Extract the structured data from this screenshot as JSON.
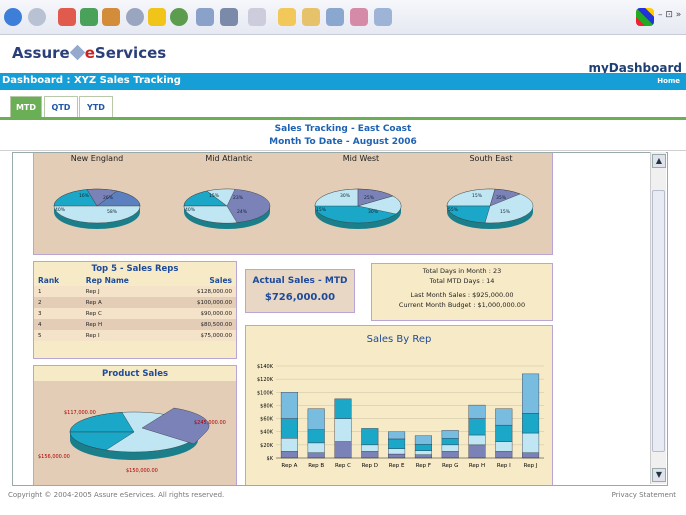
{
  "header": {
    "logo_part1": "Assure",
    "logo_part2": "e",
    "logo_part3": "Services",
    "mydashboard": "myDashboard",
    "home_link": "Home",
    "dashboard_title": "Dashboard : XYZ Sales Tracking"
  },
  "tabs": [
    {
      "label": "MTD",
      "active": true
    },
    {
      "label": "QTD",
      "active": false
    },
    {
      "label": "YTD",
      "active": false
    }
  ],
  "section": {
    "title": "Sales Tracking - East Coast",
    "subtitle": "Month To Date - August 2006"
  },
  "regions": [
    "New England",
    "Mid Atlantic",
    "Mid West",
    "South East"
  ],
  "region_pies": [
    [
      "16%",
      "26%",
      "58%",
      "40%"
    ],
    [
      "15%",
      "23%",
      "24%",
      "40%"
    ],
    [
      "30%",
      "25%",
      "30%",
      "15%"
    ],
    [
      "15%",
      "35%",
      "15%",
      "55%"
    ]
  ],
  "top5": {
    "title": "Top 5 - Sales Reps",
    "headers": [
      "Rank",
      "Rep Name",
      "Sales"
    ],
    "rows": [
      [
        "1",
        "Rep J",
        "$128,000.00"
      ],
      [
        "2",
        "Rep A",
        "$100,000.00"
      ],
      [
        "3",
        "Rep C",
        "$90,000.00"
      ],
      [
        "4",
        "Rep H",
        "$80,500.00"
      ],
      [
        "5",
        "Rep I",
        "$75,000.00"
      ]
    ]
  },
  "actual_sales": {
    "title": "Actual Sales - MTD",
    "value": "$726,000.00"
  },
  "stats": {
    "days_in_month": "Total Days in Month : 23",
    "mtd_days": "Total MTD Days : 14",
    "last_month": "Last Month Sales : $925,000.00",
    "budget": "Current Month Budget : $1,000,000.00"
  },
  "product_sales": {
    "title": "Product Sales",
    "labels": [
      "$117,000.00",
      "$245,000.00",
      "$156,000.00",
      "$150,000.00"
    ]
  },
  "footer": {
    "copyright": "Copyright © 2004-2005 Assure eServices. All rights reserved.",
    "privacy": "Privacy Statement"
  },
  "colors": {
    "blue_bar": "#169fd7",
    "tab_green": "#6aae55",
    "panel_tan": "#e3cdb6",
    "panel_cream": "#f7ebc7",
    "bar_purple": "#7b82b8",
    "bar_teal": "#1aa7c8",
    "bar_light": "#bfe6f2",
    "bar_sky": "#78bde0"
  },
  "chart_data": {
    "type": "bar",
    "title": "Sales By Rep",
    "categories": [
      "Rep A",
      "Rep B",
      "Rep C",
      "Rep D",
      "Rep E",
      "Rep F",
      "Rep G",
      "Rep H",
      "Rep I",
      "Rep J"
    ],
    "y_ticks": [
      "$140K",
      "$120K",
      "$100K",
      "$80K",
      "$60K",
      "$40K",
      "$20K",
      "$K"
    ],
    "ylim": [
      0,
      140000
    ],
    "stacked": true,
    "series": [
      {
        "color": "#7b82b8",
        "values": [
          10000,
          8000,
          25000,
          10000,
          6000,
          5000,
          10000,
          20000,
          10000,
          8000
        ]
      },
      {
        "color": "#bfe6f2",
        "values": [
          20000,
          15000,
          35000,
          10000,
          8000,
          6000,
          10000,
          15000,
          15000,
          30000
        ]
      },
      {
        "color": "#1aa7c8",
        "values": [
          30000,
          20000,
          30000,
          25000,
          15000,
          10000,
          10000,
          25000,
          25000,
          30000
        ]
      },
      {
        "color": "#78bde0",
        "values": [
          40000,
          32000,
          0,
          0,
          11000,
          13000,
          12000,
          20500,
          25000,
          60000
        ]
      }
    ]
  }
}
